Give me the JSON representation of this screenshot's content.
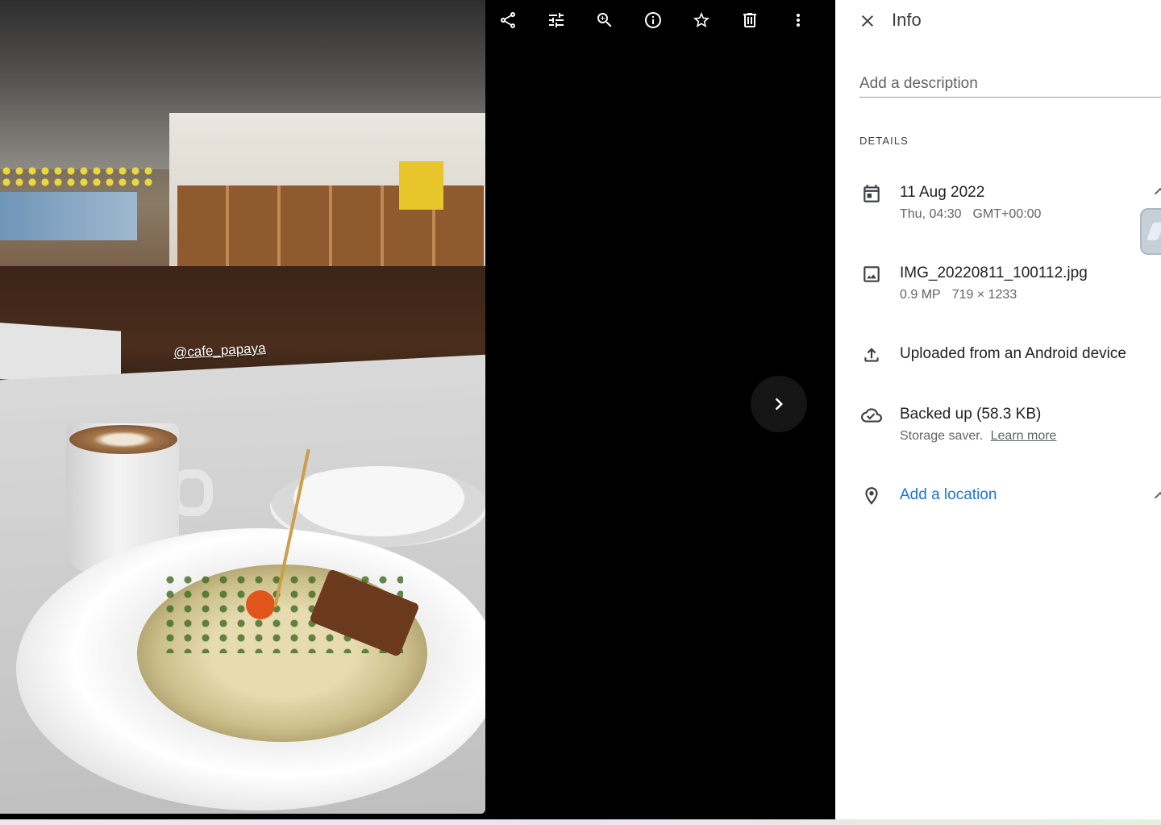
{
  "photo": {
    "watermark": "@cafe_papaya"
  },
  "toolbar": {
    "items": [
      {
        "name": "share-icon",
        "label": "Share"
      },
      {
        "name": "edit-icon",
        "label": "Edit"
      },
      {
        "name": "zoom-icon",
        "label": "Zoom"
      },
      {
        "name": "info-icon",
        "label": "Info"
      },
      {
        "name": "favorite-icon",
        "label": "Favorite"
      },
      {
        "name": "delete-icon",
        "label": "Delete"
      },
      {
        "name": "more-options-icon",
        "label": "More options"
      }
    ]
  },
  "next_button": {
    "icon": "chevron-right-icon"
  },
  "panel": {
    "title": "Info",
    "description_placeholder": "Add a description",
    "details_label": "DETAILS",
    "date": {
      "primary": "11 Aug 2022",
      "day_time": "Thu, 04:30",
      "timezone": "GMT+00:00",
      "icon": "calendar-icon"
    },
    "file": {
      "name": "IMG_20220811_100112.jpg",
      "megapixels": "0.9 MP",
      "dimensions": "719 × 1233",
      "icon": "image-icon"
    },
    "upload": {
      "text": "Uploaded from an Android device",
      "icon": "upload-icon"
    },
    "backup": {
      "text": "Backed up (58.3 KB)",
      "note": "Storage saver.",
      "link": "Learn more",
      "icon": "cloud-done-icon"
    },
    "location": {
      "text": "Add a location",
      "icon": "location-pin-icon"
    }
  },
  "colors": {
    "panel_bg": "#ffffff",
    "viewer_bg": "#000000",
    "link_blue": "#1a73e8",
    "secondary_text": "#5f6368"
  }
}
